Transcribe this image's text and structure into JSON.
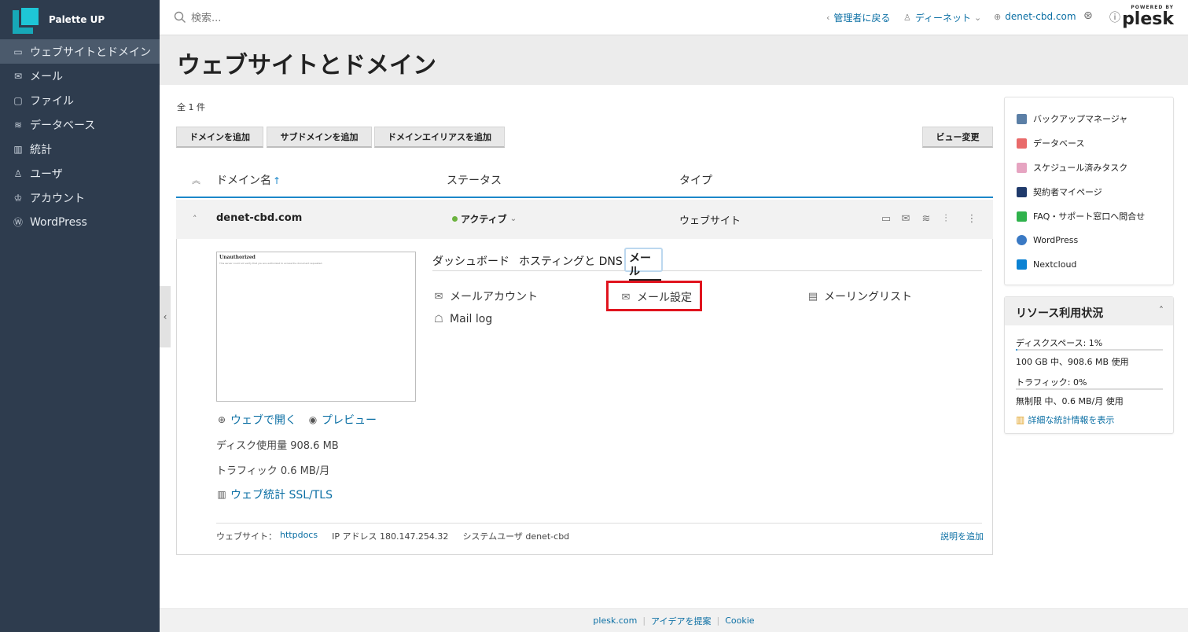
{
  "app": {
    "name": "Palette UP"
  },
  "sidebar": {
    "items": [
      {
        "label": "ウェブサイトとドメイン",
        "icon": "monitor-icon",
        "active": true
      },
      {
        "label": "メール",
        "icon": "mail-icon"
      },
      {
        "label": "ファイル",
        "icon": "folder-icon"
      },
      {
        "label": "データベース",
        "icon": "database-icon"
      },
      {
        "label": "統計",
        "icon": "chart-icon"
      },
      {
        "label": "ユーザ",
        "icon": "user-icon"
      },
      {
        "label": "アカウント",
        "icon": "account-icon"
      },
      {
        "label": "WordPress",
        "icon": "wordpress-icon"
      }
    ]
  },
  "header": {
    "search_placeholder": "検索...",
    "back_admin": "管理者に戻る",
    "user": "ディーネット",
    "domain": "denet-cbd.com",
    "powered_by": "POWERED BY",
    "brand": "plesk"
  },
  "page": {
    "title": "ウェブサイトとドメイン",
    "count": "全 1 件"
  },
  "toolbar": {
    "add_domain": "ドメインを追加",
    "add_subdomain": "サブドメインを追加",
    "add_alias": "ドメインエイリアスを追加",
    "change_view": "ビュー変更"
  },
  "table": {
    "columns": {
      "name": "ドメイン名",
      "sort_arrow": "↑",
      "status": "ステータス",
      "type": "タイプ"
    },
    "row": {
      "domain": "denet-cbd.com",
      "status": "アクティブ",
      "type": "ウェブサイト",
      "status_color": "#6cb33f"
    }
  },
  "preview": {
    "title": "Unauthorized",
    "body": "This server could not verify that you are authorized to access the document requested."
  },
  "site_links": {
    "open_web": "ウェブで開く",
    "preview": "プレビュー",
    "disk_usage": "ディスク使用量 908.6 MB",
    "traffic": "トラフィック 0.6 MB/月",
    "web_stats": "ウェブ統計 SSL/TLS"
  },
  "tabs": {
    "dashboard": "ダッシュボード",
    "hosting": "ホスティングと DNS",
    "mail": "メール"
  },
  "mail_tools": {
    "accounts": "メールアカウント",
    "settings": "メール設定",
    "mailing_lists": "メーリングリスト",
    "log": "Mail log"
  },
  "details": {
    "website_label": "ウェブサイト：",
    "website_value": "httpdocs",
    "ip": "IP アドレス 180.147.254.32",
    "sysuser": "システムユーザ denet-cbd",
    "add_desc": "説明を追加"
  },
  "side_links": [
    {
      "label": "バックアップマネージャ",
      "color": "#5b7fa6"
    },
    {
      "label": "データベース",
      "color": "#e96a6a"
    },
    {
      "label": "スケジュール済みタスク",
      "color": "#e6a4c1"
    },
    {
      "label": "契約者マイページ",
      "color": "#1f3a6b"
    },
    {
      "label": "FAQ・サポート窓口へ問合せ",
      "color": "#2fb24c"
    },
    {
      "label": "WordPress",
      "color": "#3a79c4"
    },
    {
      "label": "Nextcloud",
      "color": "#0b82d3"
    }
  ],
  "resources": {
    "title": "リソース利用状況",
    "disk_label": "ディスクスペース: 1%",
    "disk_percent": 1,
    "disk_detail": "100 GB 中、908.6 MB 使用",
    "traffic_label": "トラフィック: 0%",
    "traffic_percent": 0,
    "traffic_detail": "無制限 中、0.6 MB/月 使用",
    "details_link": "詳細な統計情報を表示"
  },
  "footer": {
    "plesk": "plesk.com",
    "ideas": "アイデアを提案",
    "cookie": "Cookie"
  }
}
